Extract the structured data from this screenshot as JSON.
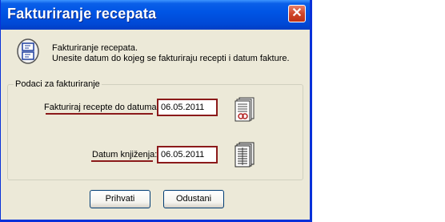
{
  "dialog": {
    "title": "Fakturiranje recepata",
    "close_label": "✕",
    "info_line1": "Fakturiranje recepata.",
    "info_line2": "Unesite datum do kojeg se fakturiraju recepti i datum fakture.",
    "group_label": "Podaci za fakturiranje",
    "fields": [
      {
        "label": "Fakturiraj recepte do datuma:",
        "value": "06.05.2011"
      },
      {
        "label": "Datum knjiženja:",
        "value": "06.05.2011"
      }
    ],
    "buttons": {
      "accept_label": "Prihvati",
      "cancel_label": "Odustani"
    },
    "colors": {
      "title_bar": "#0055e5",
      "accent_underline": "#8b1a1a",
      "dialog_bg": "#ece9d8"
    },
    "icons": [
      "document-pair-icon",
      "invoice-icon",
      "ledger-icon",
      "close-icon"
    ]
  }
}
